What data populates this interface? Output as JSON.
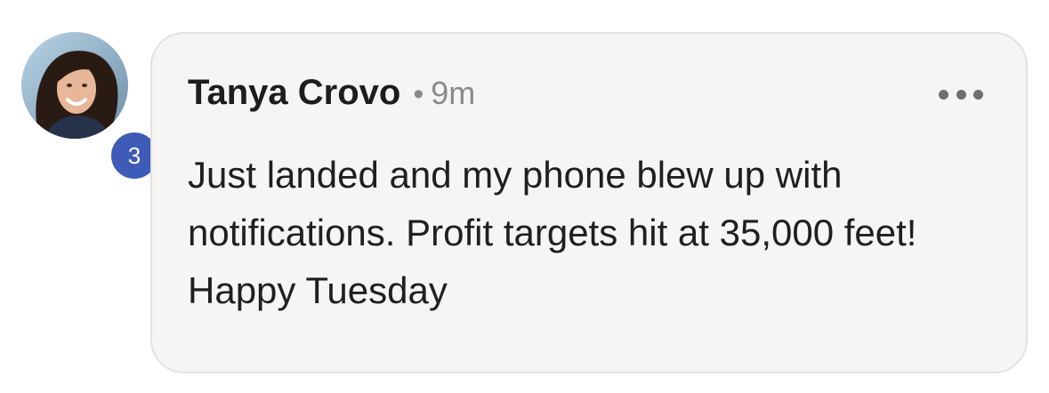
{
  "comment": {
    "author": "Tanya Crovo",
    "separator": "•",
    "timestamp": "9m",
    "text": "Just landed and my phone blew up with notifications. Profit targets hit at 35,000 feet! Happy Tuesday",
    "badge_count": "3",
    "more_icon": "ellipsis-horizontal-icon"
  },
  "colors": {
    "bubble_background": "#f6f5f4",
    "bubble_border": "#e3e2e0",
    "badge_background": "#3f5bb8",
    "author_text": "#1d1d1d",
    "meta_text": "#8a8a8a"
  }
}
